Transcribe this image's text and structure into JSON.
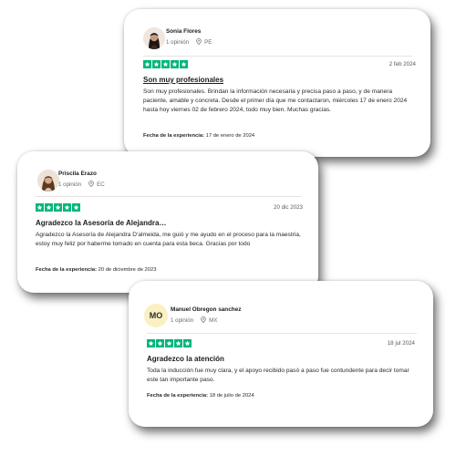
{
  "reviews": [
    {
      "name": "Sonia Flores",
      "opinions": "1 opinión",
      "country": "PE",
      "rating": 5,
      "date": "2 feb 2024",
      "title": "Son muy profesionales",
      "body": "Son muy profesionales. Brindan la información necesaria y precisa paso a paso, y de manera paciente, amable y concreta. Desde el primer día que me contactaron, miércoles 17 de enero 2024 hasta hoy viernes 02 de febrero 2024, todo muy bien. Muchas gracias.",
      "experience_label": "Fecha de la experiencia:",
      "experience_date": "17 de enero de 2024"
    },
    {
      "name": "Priscila Erazo",
      "opinions": "1 opinión",
      "country": "EC",
      "rating": 5,
      "date": "20 dic 2023",
      "title": "Agradezco la Asesoría de Alejandra…",
      "body": "Agradezco la Asesoría de Alejandra D'almeida, me guió y me ayudo en el proceso para la maestria, estoy muy feliz por haberme tomado en cuenta para esta beca. Gracias por todo",
      "experience_label": "Fecha de la experiencia:",
      "experience_date": "20 de diciembre de 2023"
    },
    {
      "name": "Manuel Obregon sanchez",
      "initials": "MO",
      "opinions": "1 opinión",
      "country": "MX",
      "rating": 5,
      "date": "18 jul 2024",
      "title": "Agradezco la atención",
      "body": "Toda la inducción fue muy clara, y el apoyo recibido pasó a paso fue contundente para decir tomar este tan importante paso.",
      "experience_label": "Fecha de la experiencia:",
      "experience_date": "18 de julio de 2024"
    }
  ],
  "colors": {
    "star_green": "#00b67a",
    "initials_bg": "#fcf0c2"
  },
  "icons": {
    "location": "map-pin-icon",
    "star": "star-icon"
  }
}
